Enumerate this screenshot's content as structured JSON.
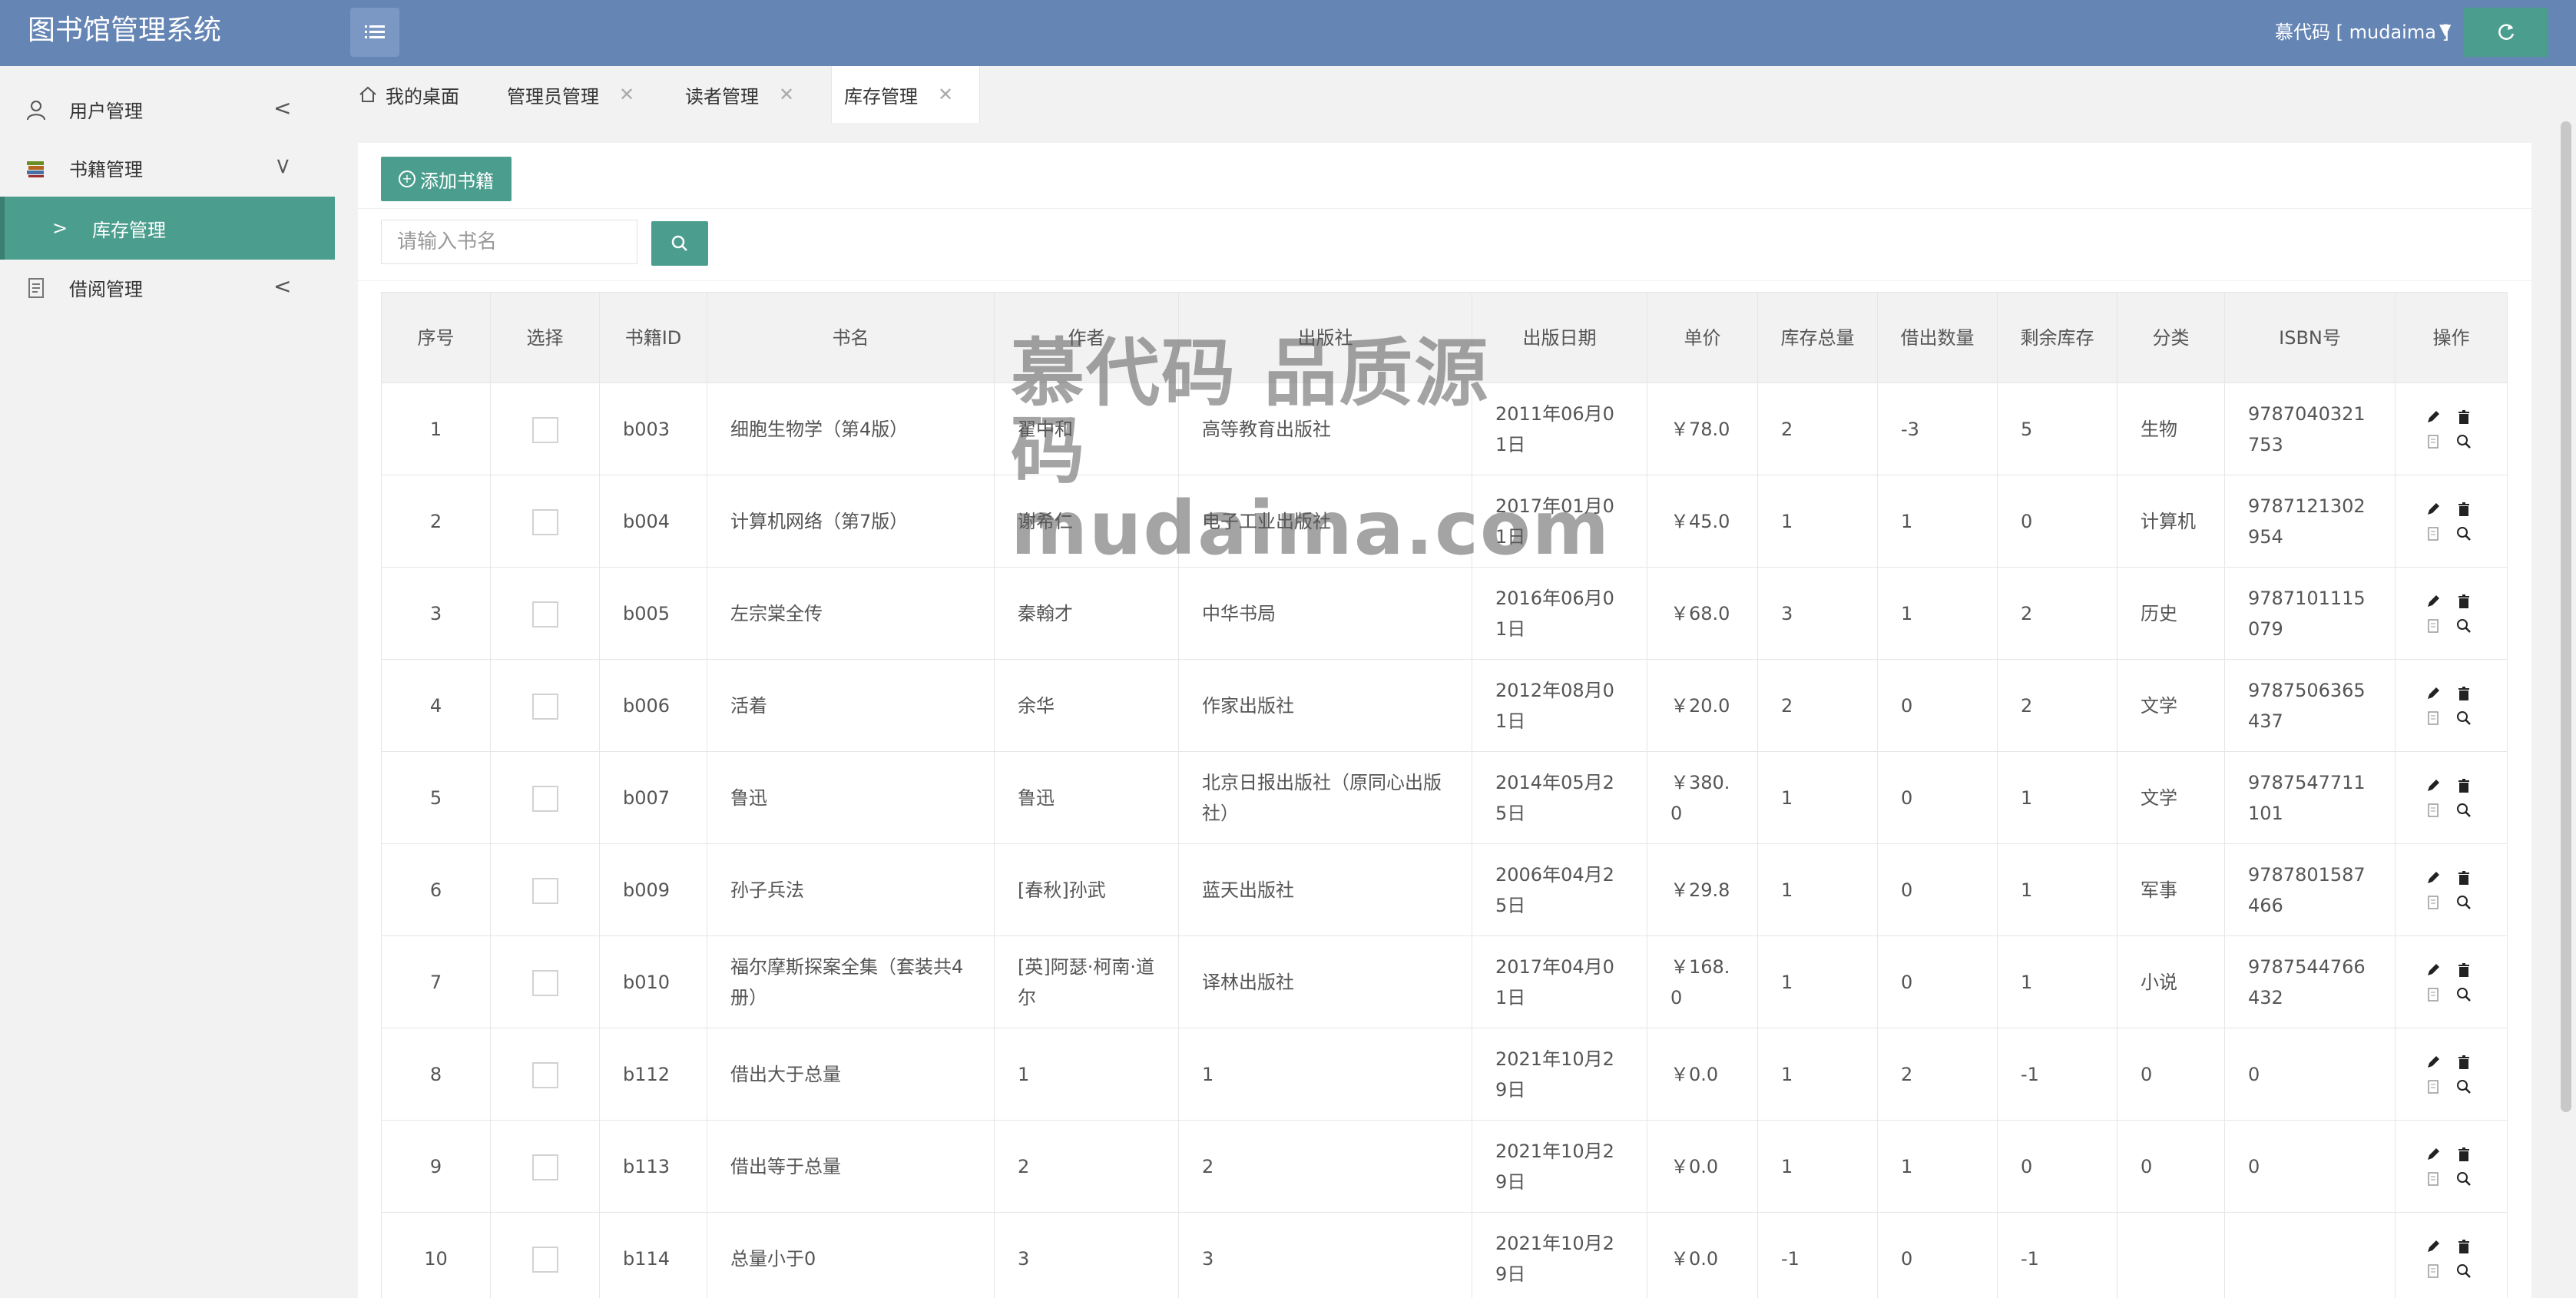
{
  "header": {
    "title": "图书馆管理系统",
    "user": "慕代码 [ mudaima ]",
    "menu_icon": "list-icon",
    "refresh_icon": "refresh-icon"
  },
  "sidebar": {
    "items": [
      {
        "label": "用户管理",
        "icon": "user-icon",
        "arrow": "<"
      },
      {
        "label": "书籍管理",
        "icon": "books-icon",
        "arrow": "v"
      },
      {
        "label": "借阅管理",
        "icon": "document-icon",
        "arrow": "<"
      }
    ],
    "sub_item": {
      "label": "库存管理",
      "chevron": ">"
    }
  },
  "tabs": [
    {
      "label": "我的桌面",
      "icon": "home-icon",
      "closable": false
    },
    {
      "label": "管理员管理",
      "closable": true
    },
    {
      "label": "读者管理",
      "closable": true
    },
    {
      "label": "库存管理",
      "closable": true,
      "active": true
    }
  ],
  "tab_close": "✕",
  "toolbar": {
    "add_label": "添加书籍"
  },
  "search": {
    "placeholder": "请输入书名"
  },
  "table": {
    "headers": [
      "序号",
      "选择",
      "书籍ID",
      "书名",
      "作者",
      "出版社",
      "出版日期",
      "单价",
      "库存总量",
      "借出数量",
      "剩余库存",
      "分类",
      "ISBN号",
      "操作"
    ],
    "rows": [
      [
        "1",
        "",
        "b003",
        "细胞生物学（第4版）",
        "翟中和",
        "高等教育出版社",
        "2011年06月01日",
        "￥78.0",
        "2",
        "-3",
        "5",
        "生物",
        "9787040321753"
      ],
      [
        "2",
        "",
        "b004",
        "计算机网络（第7版）",
        "谢希仁",
        "电子工业出版社",
        "2017年01月01日",
        "￥45.0",
        "1",
        "1",
        "0",
        "计算机",
        "9787121302954"
      ],
      [
        "3",
        "",
        "b005",
        "左宗棠全传",
        "秦翰才",
        "中华书局",
        "2016年06月01日",
        "￥68.0",
        "3",
        "1",
        "2",
        "历史",
        "9787101115079"
      ],
      [
        "4",
        "",
        "b006",
        "活着",
        "余华",
        "作家出版社",
        "2012年08月01日",
        "￥20.0",
        "2",
        "0",
        "2",
        "文学",
        "9787506365437"
      ],
      [
        "5",
        "",
        "b007",
        "鲁迅",
        "鲁迅",
        "北京日报出版社（原同心出版社）",
        "2014年05月25日",
        "￥380.0",
        "1",
        "0",
        "1",
        "文学",
        "9787547711101"
      ],
      [
        "6",
        "",
        "b009",
        "孙子兵法",
        "[春秋]孙武",
        "蓝天出版社",
        "2006年04月25日",
        "￥29.8",
        "1",
        "0",
        "1",
        "军事",
        "9787801587466"
      ],
      [
        "7",
        "",
        "b010",
        "福尔摩斯探案全集（套装共4册）",
        "[英]阿瑟·柯南·道尔",
        "译林出版社",
        "2017年04月01日",
        "￥168.0",
        "1",
        "0",
        "1",
        "小说",
        "9787544766432"
      ],
      [
        "8",
        "",
        "b112",
        "借出大于总量",
        "1",
        "1",
        "2021年10月29日",
        "￥0.0",
        "1",
        "2",
        "-1",
        "0",
        "0"
      ],
      [
        "9",
        "",
        "b113",
        "借出等于总量",
        "2",
        "2",
        "2021年10月29日",
        "￥0.0",
        "1",
        "1",
        "0",
        "0",
        "0"
      ],
      [
        "10",
        "",
        "b114",
        "总量小于0",
        "3",
        "3",
        "2021年10月29日",
        "￥0.0",
        "-1",
        "0",
        "-1",
        "",
        ""
      ]
    ],
    "op_icons": [
      "edit-icon",
      "delete-icon",
      "detail-icon",
      "search-icon"
    ]
  },
  "watermark": {
    "line1": "慕代码 品质源码",
    "line2": "mudaima.com"
  },
  "colors": {
    "header": "#6585b5",
    "accent": "#4b9e8e",
    "sidebar_bg": "#f2f2f2"
  }
}
